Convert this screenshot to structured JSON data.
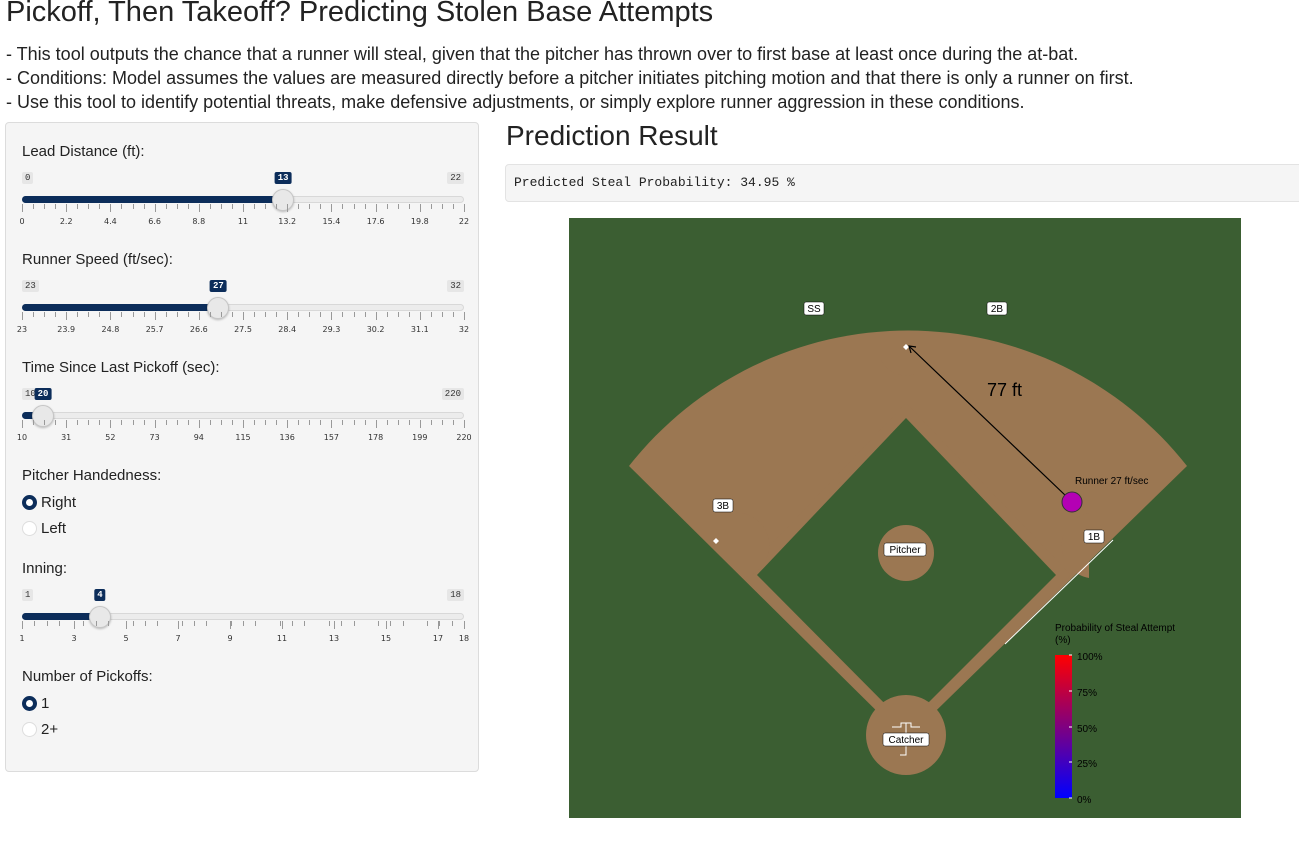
{
  "page": {
    "title": "Pickoff, Then Takeoff? Predicting Stolen Base Attempts",
    "description": [
      "- This tool outputs the chance that a runner will steal, given that the pitcher has thrown over to first base at least once during the at-bat.",
      "- Conditions: Model assumes the values are measured directly before a pitcher initiates pitching motion and that there is only a runner on first.",
      "- Use this tool to identify potential threats, make defensive adjustments, or simply explore runner aggression in these conditions."
    ]
  },
  "inputs": {
    "lead": {
      "label": "Lead Distance (ft):",
      "min": "0",
      "max": "22",
      "value": "13",
      "fraction": 0.5909,
      "grid": [
        "0",
        "2.2",
        "4.4",
        "6.6",
        "8.8",
        "11",
        "13.2",
        "15.4",
        "17.6",
        "19.8",
        "22"
      ]
    },
    "speed": {
      "label": "Runner Speed (ft/sec):",
      "min": "23",
      "max": "32",
      "value": "27",
      "fraction": 0.4444,
      "grid": [
        "23",
        "23.9",
        "24.8",
        "25.7",
        "26.6",
        "27.5",
        "28.4",
        "29.3",
        "30.2",
        "31.1",
        "32"
      ]
    },
    "time": {
      "label": "Time Since Last Pickoff (sec):",
      "min": "10",
      "max": "220",
      "value": "20",
      "fraction": 0.0476,
      "grid": [
        "10",
        "31",
        "52",
        "73",
        "94",
        "115",
        "136",
        "157",
        "178",
        "199",
        "220"
      ]
    },
    "hand": {
      "label": "Pitcher Handedness:",
      "options": [
        "Right",
        "Left"
      ],
      "selected": "Right"
    },
    "inning": {
      "label": "Inning:",
      "min": "1",
      "max": "18",
      "value": "4",
      "fraction": 0.1765,
      "grid": [
        "1",
        "3",
        "5",
        "7",
        "9",
        "11",
        "13",
        "15",
        "17",
        "18"
      ]
    },
    "pickoffs": {
      "label": "Number of Pickoffs:",
      "options": [
        "1",
        "2+"
      ],
      "selected": "1"
    }
  },
  "result": {
    "title": "Prediction Result",
    "output": "Predicted Steal Probability: 34.95 %"
  },
  "field": {
    "colors": {
      "grass": "#3b5e32",
      "dirt": "#9b7752",
      "runner": "#b400b4"
    },
    "labels": {
      "ss": "SS",
      "second": "2B",
      "third": "3B",
      "first": "1B",
      "pitcher": "Pitcher",
      "catcher": "Catcher",
      "distance": "77 ft",
      "runner": "Runner 27 ft/sec"
    },
    "legend": {
      "title": "Probability of Steal Attempt (%)",
      "ticks": [
        "100%",
        "75%",
        "50%",
        "25%",
        "0%"
      ],
      "colors": {
        "top": "#ff0000",
        "bottom": "#0000ff"
      }
    }
  }
}
